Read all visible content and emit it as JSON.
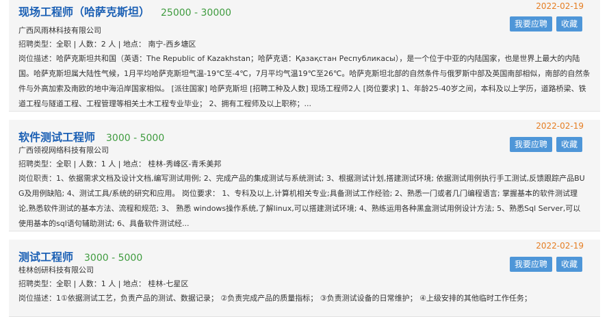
{
  "jobs": [
    {
      "title": "现场工程师（哈萨克斯坦）",
      "salary": "25000 - 30000",
      "date": "2022-02-19",
      "company": "广西风雨林科技有限公司",
      "meta_label": "招聘类型：",
      "meta": "全职 | 人数：2 人 | 地点： 南宁-西乡塘区",
      "desc_label": "岗位描述：",
      "desc": "哈萨克斯坦共和国（英语：The Republic of Kazakhstan；哈萨克语：Қазақстан Республикасы），是一个位于中亚的内陆国家，也是世界上最大的内陆国。哈萨克斯坦属大陆性气候，1月平均哈萨克斯坦气温-19℃至-4℃，7月平均气温19℃至26℃。哈萨克斯坦北部的自然条件与俄罗斯中部及英国南部相似，南部的自然条件与外高加索及南欧的地中海沿岸国家相似。 [派往国家] 哈萨克斯坦 [招聘工种及人数] 现场工程师2人 [岗位要求] 1、年龄25-40岁之间，本科及以上学历，道路桥梁、铁道工程与隧道工程、工程管理等相关土木工程专业毕业； 2、拥有工程师及以上职称；..."
    },
    {
      "title": "软件测试工程师",
      "salary": "3000 - 5000",
      "date": "2022-02-19",
      "company": "广西领视网络科技有限公司",
      "meta_label": "招聘类型：",
      "meta": "全职 | 人数：1 人 | 地点： 桂林-秀峰区-青禾美邦",
      "desc_label": "岗位职责：",
      "desc": "1、依据需求文档及设计文档,编写测试用例; 2、完成产品的集成测试与系统测试; 3、根据测试计划,搭建测试环境; 依据测试用例执行手工测试,反馈跟踪产品BUG及用例缺陷; 4、测试工具/系统的研究和应用。 岗位要求： 1、专科及以上,计算机相关专业;具备测试工作经验; 2、熟悉一门或者几门编程语言; 掌握基本的软件测试理论,熟悉软件测试的基本方法、流程和规范; 3、 熟悉 windows操作系统,了解linux,可以搭建测试环境; 4、熟练运用各种黑盒测试用例设计方法; 5、熟悉Sql Server,可以使用基本的sql语句辅助测试; 6、具备软件测试经..."
    },
    {
      "title": "测试工程师",
      "salary": "3000 - 5000",
      "date": "2022-02-19",
      "company": "桂林创研科技有限公司",
      "meta_label": "招聘类型：",
      "meta": "全职 | 人数：1 人 | 地点： 桂林-七星区",
      "desc_label": "岗位描述：",
      "desc": "1①依据测试工艺，负责产品的测试、数据记录； ②负责完成产品的质量指标； ③负责测试设备的日常维护； ④上级安排的其他临时工作任务；"
    }
  ],
  "buttons": {
    "apply": "我要应聘",
    "favorite": "收藏"
  },
  "colors": {
    "title": "#1a5fb4",
    "salary": "#3e9b3e",
    "date": "#e57d22",
    "button": "#4e96d8"
  }
}
